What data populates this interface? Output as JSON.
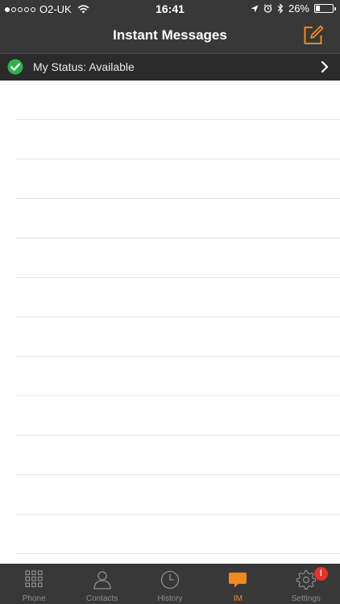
{
  "status_bar": {
    "carrier": "O2-UK",
    "time": "16:41",
    "battery": "26%",
    "battery_level": 0.26
  },
  "nav": {
    "title": "Instant Messages",
    "compose_icon": "compose-icon"
  },
  "my_status": {
    "label": "My Status: Available",
    "status_color": "#2fb24c"
  },
  "tabs": [
    {
      "label": "Phone",
      "icon": "keypad-icon",
      "active": false
    },
    {
      "label": "Contacts",
      "icon": "person-icon",
      "active": false
    },
    {
      "label": "History",
      "icon": "clock-icon",
      "active": false
    },
    {
      "label": "IM",
      "icon": "chat-bubble-icon",
      "active": true
    },
    {
      "label": "Settings",
      "icon": "gear-icon",
      "active": false,
      "badge": "!"
    }
  ],
  "colors": {
    "accent": "#f08a1c",
    "bar_background": "#383838",
    "badge": "#e8302a"
  }
}
